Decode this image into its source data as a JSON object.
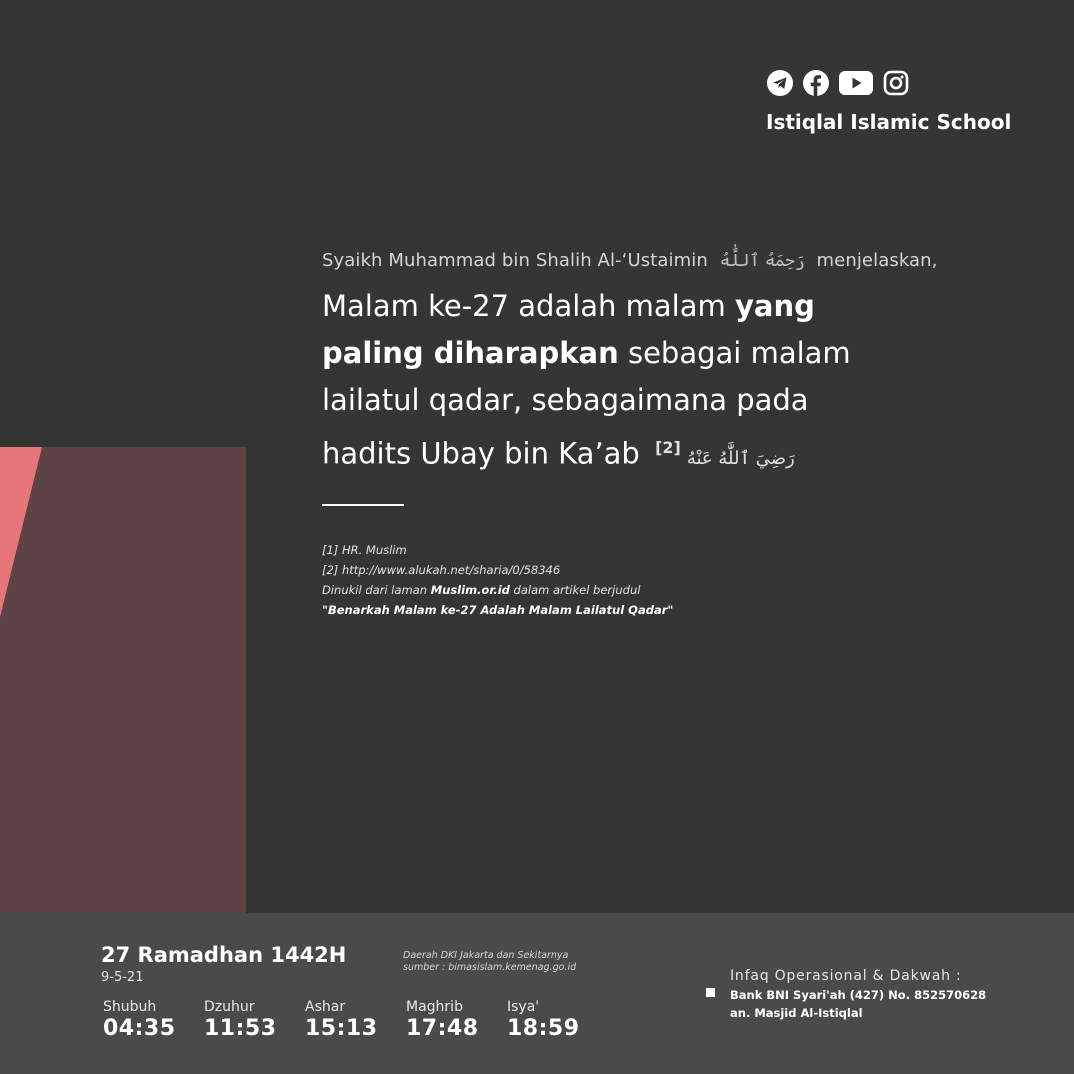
{
  "brand": {
    "name": "Istiqlal Islamic School",
    "social_icons": [
      "telegram-icon",
      "facebook-icon",
      "youtube-icon",
      "instagram-icon"
    ]
  },
  "quote": {
    "intro_before": "Syaikh Muhammad bin Shalih Al-‘Ustaimin",
    "intro_honorific": "رَحِمَهُ ٱللَّٰهُ",
    "intro_after": "menjelaskan,",
    "line1_normal": "Malam ke-27 adalah malam ",
    "line1_bold": "yang paling diharapkan",
    "line2_normal": " sebagai malam lailatul qadar, sebagaimana pada hadits Ubay bin Ka’ab",
    "honorific": "رَضِيَ ٱللَّٰهُ عَنْهُ",
    "citation": "[2]"
  },
  "references": {
    "ref1": "[1] HR. Muslim",
    "ref2": "[2] http://www.alukah.net/sharia/0/58346",
    "source_prefix": "Dinukil dari laman ",
    "source_site": "Muslim.or.id",
    "source_suffix": " dalam artikel berjudul",
    "article_title": "\"Benarkah Malam ke-27 Adalah Malam Lailatul Qadar\""
  },
  "footer": {
    "hijri_date": "27 Ramadhan 1442H",
    "gregorian_date": "9-5-21",
    "region": "Daerah DKI Jakarta dan Sekitarnya",
    "source": "sumber : bimasislam.kemenag.go.id",
    "prayers": [
      {
        "name": "Shubuh",
        "time": "04:35"
      },
      {
        "name": "Dzuhur",
        "time": "11:53"
      },
      {
        "name": "Ashar",
        "time": "15:13"
      },
      {
        "name": "Maghrib",
        "time": "17:48"
      },
      {
        "name": "Isya'",
        "time": "18:59"
      }
    ],
    "infaq": {
      "title": "Infaq Operasional & Dakwah :",
      "bank": "Bank BNI Syari'ah (427) No. 852570628",
      "owner": "an. Masjid Al-Istiqlal"
    }
  },
  "colors": {
    "background": "#353535",
    "footer": "#4a4a4a",
    "accent_block": "#5e4346",
    "accent_stripe": "#e77678"
  }
}
